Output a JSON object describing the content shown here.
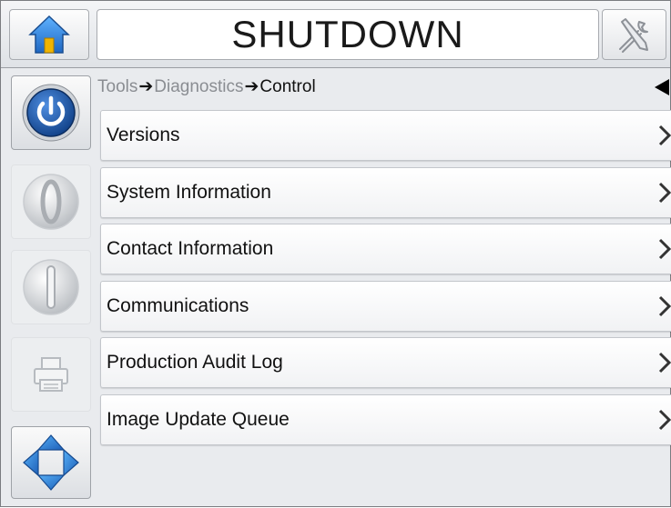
{
  "header": {
    "status": "SHUTDOWN",
    "home_icon": "home-icon",
    "tools_icon": "tools-icon"
  },
  "sidebar": {
    "items": [
      {
        "name": "power",
        "icon": "power-icon"
      },
      {
        "name": "start",
        "icon": "start-icon"
      },
      {
        "name": "stop",
        "icon": "stop-icon"
      },
      {
        "name": "print",
        "icon": "printer-icon"
      },
      {
        "name": "navigate",
        "icon": "navigation-arrows-icon"
      }
    ]
  },
  "breadcrumb": {
    "items": [
      "Tools",
      "Diagnostics",
      "Control"
    ],
    "separator": "➔"
  },
  "menu": {
    "items": [
      {
        "label": "Versions"
      },
      {
        "label": "System Information"
      },
      {
        "label": "Contact Information"
      },
      {
        "label": "Communications"
      },
      {
        "label": "Production Audit Log"
      },
      {
        "label": "Image Update Queue"
      }
    ]
  },
  "colors": {
    "power_blue": "#1f5aa6",
    "home_blue": "#3a86d6",
    "background": "#e9ebee"
  }
}
